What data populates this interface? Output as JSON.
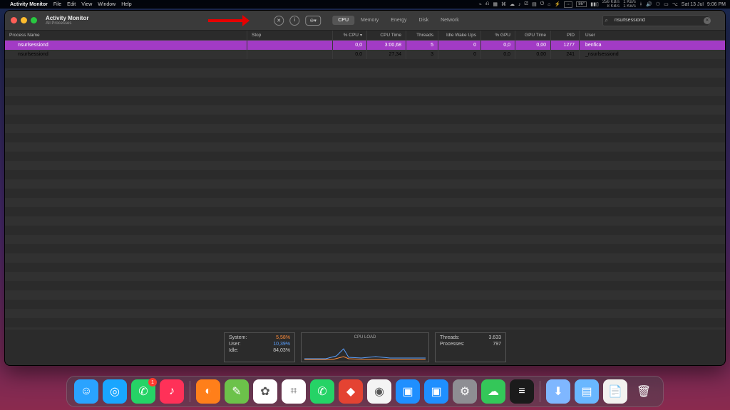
{
  "menubar": {
    "app": "Activity Monitor",
    "items": [
      "File",
      "Edit",
      "View",
      "Window",
      "Help"
    ],
    "status_temp": "86°",
    "status_net_up": "256 KB/s",
    "status_net_dn": "8 KB/s",
    "status_net2_up": "1 KB/s",
    "status_net2_dn": "1 KB/s",
    "date": "Sat 13 Jul",
    "time": "9:06 PM"
  },
  "window": {
    "title": "Activity Monitor",
    "subtitle": "All Processes",
    "tabs": [
      "CPU",
      "Memory",
      "Energy",
      "Disk",
      "Network"
    ],
    "active_tab": 0,
    "search_value": "nsurlsessiond"
  },
  "columns": {
    "name": "Process Name",
    "stop": "Stop",
    "cpu": "% CPU",
    "time": "CPU Time",
    "threads": "Threads",
    "idle": "Idle Wake Ups",
    "gpu": "% GPU",
    "gtime": "GPU Time",
    "pid": "PID",
    "user": "User"
  },
  "rows": [
    {
      "name": "nsurlsessiond",
      "cpu": "0,0",
      "time": "3:00,68",
      "threads": "5",
      "idle": "0",
      "gpu": "0,0",
      "gtime": "0,00",
      "pid": "1277",
      "user": "benfica",
      "selected": true
    },
    {
      "name": "nsurlsessiond",
      "cpu": "0,0",
      "time": "27,34",
      "threads": "3",
      "idle": "0",
      "gpu": "0,0",
      "gtime": "0,00",
      "pid": "241",
      "user": "_nsurlsessiond",
      "selected": false
    }
  ],
  "footer": {
    "left": [
      {
        "k": "System:",
        "v": "5,58%",
        "cls": "orange"
      },
      {
        "k": "User:",
        "v": "10,39%",
        "cls": "blue"
      },
      {
        "k": "Idle:",
        "v": "84,03%",
        "cls": ""
      }
    ],
    "chart_label": "CPU LOAD",
    "right": [
      {
        "k": "Threads:",
        "v": "3.633"
      },
      {
        "k": "Processes:",
        "v": "797"
      }
    ]
  },
  "dock": [
    {
      "name": "finder",
      "bg": "#2aa3ff",
      "glyph": "☺"
    },
    {
      "name": "safari-like",
      "bg": "#19a6ff",
      "glyph": "◎"
    },
    {
      "name": "whatsapp",
      "bg": "#25d366",
      "glyph": "✆",
      "badge": "1"
    },
    {
      "name": "music",
      "bg": "#ff3158",
      "glyph": "♪"
    },
    {
      "name": "sep"
    },
    {
      "name": "firefox",
      "bg": "#ff7f1a",
      "glyph": "◐"
    },
    {
      "name": "notes-app",
      "bg": "#6cc24a",
      "glyph": "✎"
    },
    {
      "name": "photos",
      "bg": "#ffffff",
      "glyph": "✿"
    },
    {
      "name": "slack",
      "bg": "#ffffff",
      "glyph": "⌗"
    },
    {
      "name": "whatsapp2",
      "bg": "#25d366",
      "glyph": "✆"
    },
    {
      "name": "todoist",
      "bg": "#e44332",
      "glyph": "◆"
    },
    {
      "name": "1password",
      "bg": "#f4f4f4",
      "glyph": "◉"
    },
    {
      "name": "screenshare1",
      "bg": "#1f8fff",
      "glyph": "▣"
    },
    {
      "name": "screenshare2",
      "bg": "#1f8fff",
      "glyph": "▣"
    },
    {
      "name": "settings",
      "bg": "#8e8e93",
      "glyph": "⚙"
    },
    {
      "name": "messages",
      "bg": "#34c759",
      "glyph": "☁"
    },
    {
      "name": "activity-monitor",
      "bg": "#1b1b1b",
      "glyph": "≡"
    },
    {
      "name": "sep"
    },
    {
      "name": "appstore",
      "bg": "#7fb7ff",
      "glyph": "⬇"
    },
    {
      "name": "folder",
      "bg": "#69b7ff",
      "glyph": "▤"
    },
    {
      "name": "textedit",
      "bg": "#f2f2ef",
      "glyph": "📄"
    },
    {
      "name": "trash",
      "bg": "transparent",
      "glyph": "🗑"
    }
  ]
}
